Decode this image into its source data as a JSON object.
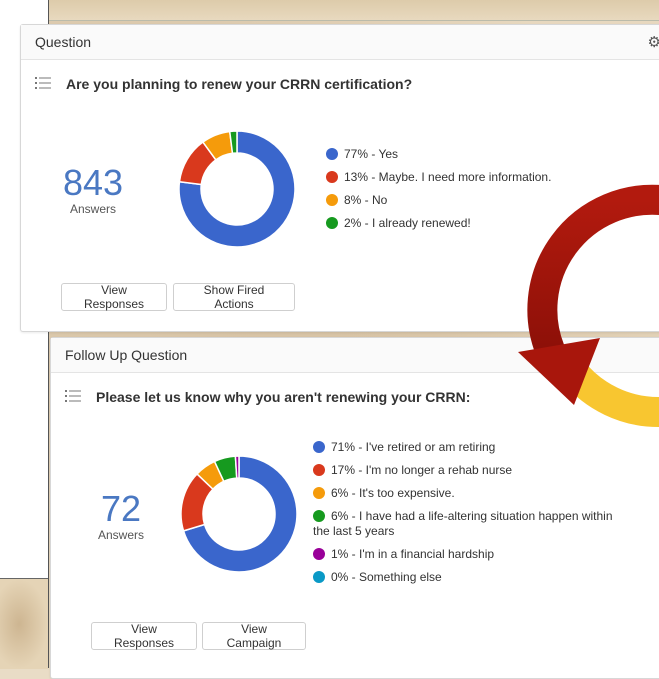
{
  "question_card": {
    "header_label": "Question",
    "icon": "gear-icon",
    "question": "Are you planning to renew your CRRN certification?",
    "answer_count": "843",
    "answers_label": "Answers",
    "buttons": {
      "view_responses": "View Responses",
      "show_fired_actions": "Show Fired Actions"
    }
  },
  "follow_up_card": {
    "header_label": "Follow Up Question",
    "question": "Please let us know why you aren't renewing your CRRN:",
    "answer_count": "72",
    "answers_label": "Answers",
    "buttons": {
      "view_responses": "View Responses",
      "view_campaign": "View Campaign"
    }
  },
  "colors": {
    "blue": "#3a66cc",
    "red": "#d9391d",
    "orange": "#f59b0b",
    "green": "#169a1f",
    "purple": "#990099",
    "teal": "#0a99c6",
    "arrow_red": "#a8160c",
    "arrow_yellow": "#f8c630"
  },
  "chart_data": [
    {
      "type": "pie",
      "style": "donut",
      "categories": [
        "Yes",
        "Maybe. I need more information.",
        "No",
        "I already renewed!"
      ],
      "values": [
        77,
        13,
        8,
        2
      ],
      "legend": [
        "77% - Yes",
        "13% - Maybe. I need more information.",
        "8% - No",
        "2% - I already renewed!"
      ],
      "colors": [
        "#3a66cc",
        "#d9391d",
        "#f59b0b",
        "#169a1f"
      ]
    },
    {
      "type": "pie",
      "style": "donut",
      "categories": [
        "I've retired or am retiring",
        "I'm no longer a rehab nurse",
        "It's too expensive.",
        "I have had a life-altering situation happen within the last 5 years",
        "I'm in a financial hardship",
        "Something else"
      ],
      "values": [
        71,
        17,
        6,
        6,
        1,
        0
      ],
      "legend": [
        "71% - I've retired or am retiring",
        "17% - I'm no longer a rehab nurse",
        "6% - It's too expensive.",
        "6% - I have had a life-altering situation happen within the last 5 years",
        "1% - I'm in a financial hardship",
        "0% - Something else"
      ],
      "colors": [
        "#3a66cc",
        "#d9391d",
        "#f59b0b",
        "#169a1f",
        "#990099",
        "#0a99c6"
      ]
    }
  ]
}
